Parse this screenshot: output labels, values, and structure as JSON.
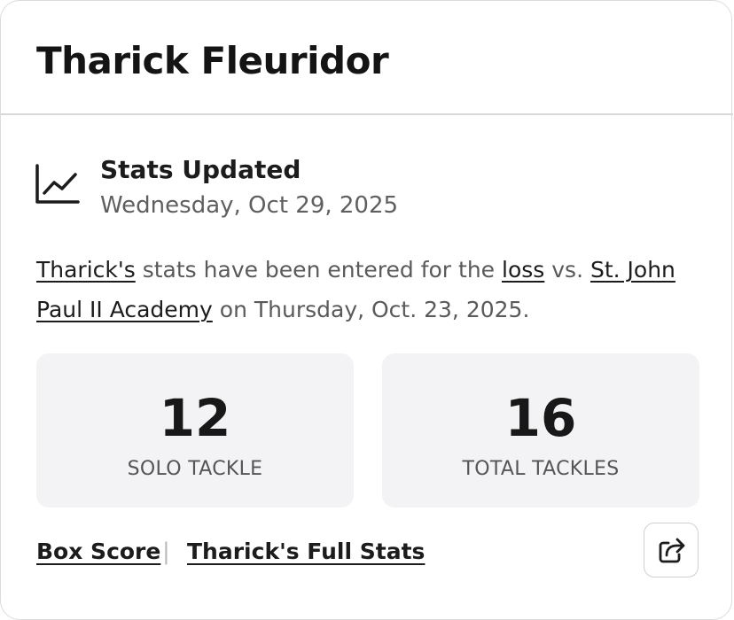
{
  "player": {
    "name": "Tharick Fleuridor"
  },
  "update": {
    "icon": "line-chart-icon",
    "title": "Stats Updated",
    "date": "Wednesday, Oct 29, 2025"
  },
  "summary": {
    "player_link": "Tharick's",
    "text1": " stats have been entered for the ",
    "result_link": "loss",
    "text2": " vs. ",
    "opponent_link": "St. John Paul II Academy",
    "text3": " on Thursday, Oct. 23, 2025."
  },
  "stats": [
    {
      "value": "12",
      "label": "SOLO TACKLE"
    },
    {
      "value": "16",
      "label": "TOTAL TACKLES"
    }
  ],
  "footer": {
    "box_score": "Box Score",
    "divider": "|",
    "full_stats": "Tharick's Full Stats",
    "share_icon": "share-icon"
  }
}
